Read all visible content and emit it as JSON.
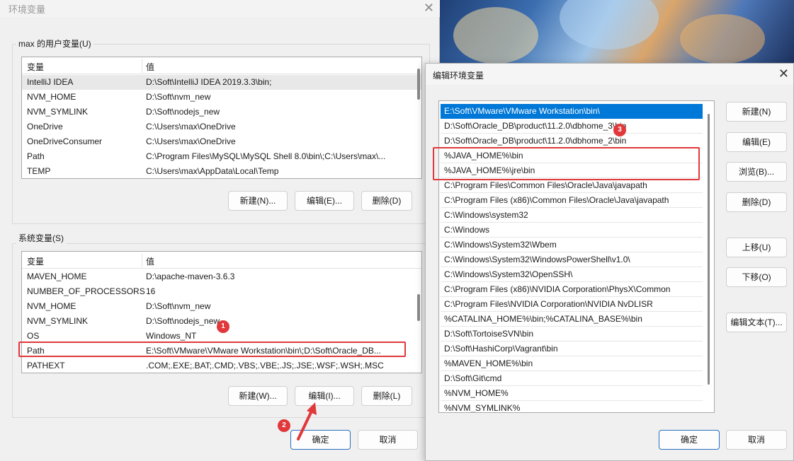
{
  "main_window": {
    "title": "环境变量",
    "user_vars": {
      "group_label": "max 的用户变量(U)",
      "col_var": "变量",
      "col_val": "值",
      "rows": [
        {
          "name": "IntelliJ IDEA",
          "value": "D:\\Soft\\IntelliJ IDEA 2019.3.3\\bin;"
        },
        {
          "name": "NVM_HOME",
          "value": "D:\\Soft\\nvm_new"
        },
        {
          "name": "NVM_SYMLINK",
          "value": "D:\\Soft\\nodejs_new"
        },
        {
          "name": "OneDrive",
          "value": "C:\\Users\\max\\OneDrive"
        },
        {
          "name": "OneDriveConsumer",
          "value": "C:\\Users\\max\\OneDrive"
        },
        {
          "name": "Path",
          "value": "C:\\Program Files\\MySQL\\MySQL Shell 8.0\\bin\\;C:\\Users\\max\\..."
        },
        {
          "name": "TEMP",
          "value": "C:\\Users\\max\\AppData\\Local\\Temp"
        }
      ],
      "buttons": {
        "new": "新建(N)...",
        "edit": "编辑(E)...",
        "delete": "删除(D)"
      }
    },
    "sys_vars": {
      "group_label": "系统变量(S)",
      "col_var": "变量",
      "col_val": "值",
      "rows": [
        {
          "name": "MAVEN_HOME",
          "value": "D:\\apache-maven-3.6.3"
        },
        {
          "name": "NUMBER_OF_PROCESSORS",
          "value": "16"
        },
        {
          "name": "NVM_HOME",
          "value": "D:\\Soft\\nvm_new"
        },
        {
          "name": "NVM_SYMLINK",
          "value": "D:\\Soft\\nodejs_new"
        },
        {
          "name": "OS",
          "value": "Windows_NT"
        },
        {
          "name": "Path",
          "value": "E:\\Soft\\VMware\\VMware Workstation\\bin\\;D:\\Soft\\Oracle_DB..."
        },
        {
          "name": "PATHEXT",
          "value": ".COM;.EXE;.BAT;.CMD;.VBS;.VBE;.JS;.JSE;.WSF;.WSH;.MSC"
        }
      ],
      "buttons": {
        "new": "新建(W)...",
        "edit": "编辑(I)...",
        "delete": "删除(L)"
      }
    },
    "ok": "确定",
    "cancel": "取消"
  },
  "edit_window": {
    "title": "编辑环境变量",
    "entries": [
      "E:\\Soft\\VMware\\VMware Workstation\\bin\\",
      "D:\\Soft\\Oracle_DB\\product\\11.2.0\\dbhome_3\\bin",
      "D:\\Soft\\Oracle_DB\\product\\11.2.0\\dbhome_2\\bin",
      "%JAVA_HOME%\\bin",
      "%JAVA_HOME%\\jre\\bin",
      "C:\\Program Files\\Common Files\\Oracle\\Java\\javapath",
      "C:\\Program Files (x86)\\Common Files\\Oracle\\Java\\javapath",
      "C:\\Windows\\system32",
      "C:\\Windows",
      "C:\\Windows\\System32\\Wbem",
      "C:\\Windows\\System32\\WindowsPowerShell\\v1.0\\",
      "C:\\Windows\\System32\\OpenSSH\\",
      "C:\\Program Files (x86)\\NVIDIA Corporation\\PhysX\\Common",
      "C:\\Program Files\\NVIDIA Corporation\\NVIDIA NvDLISR",
      "%CATALINA_HOME%\\bin;%CATALINA_BASE%\\bin",
      "D:\\Soft\\TortoiseSVN\\bin",
      "D:\\Soft\\HashiCorp\\Vagrant\\bin",
      "%MAVEN_HOME%\\bin",
      "D:\\Soft\\Git\\cmd",
      "%NVM_HOME%",
      "%NVM_SYMLINK%"
    ],
    "buttons": {
      "new": "新建(N)",
      "edit": "编辑(E)",
      "browse": "浏览(B)...",
      "delete": "删除(D)",
      "move_up": "上移(U)",
      "move_down": "下移(O)",
      "edit_text": "编辑文本(T)..."
    },
    "ok": "确定",
    "cancel": "取消"
  },
  "annotations": {
    "step1": "1",
    "step2": "2",
    "step3": "3",
    "color": "#e0383b"
  },
  "icons": {
    "close": "close-icon",
    "arrow": "arrow-annotation-icon"
  }
}
